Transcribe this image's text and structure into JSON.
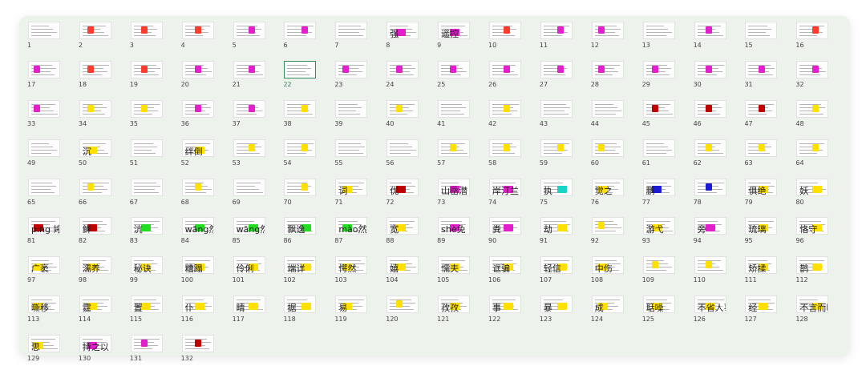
{
  "grid": {
    "selected": 22,
    "slides": [
      {
        "n": "1",
        "caption": "",
        "hl": ""
      },
      {
        "n": "2",
        "caption": "",
        "hl": "#ff3b30"
      },
      {
        "n": "3",
        "caption": "",
        "hl": "#ff3b30"
      },
      {
        "n": "4",
        "caption": "",
        "hl": "#ff3b30"
      },
      {
        "n": "5",
        "caption": "",
        "hl": "#e31ecb"
      },
      {
        "n": "6",
        "caption": "",
        "hl": "#e31ecb"
      },
      {
        "n": "7",
        "caption": "",
        "hl": ""
      },
      {
        "n": "8",
        "caption": "强",
        "hl": "#e31ecb"
      },
      {
        "n": "9",
        "caption": "遥控",
        "hl": "#e31ecb"
      },
      {
        "n": "10",
        "caption": "",
        "hl": "#ff3b30"
      },
      {
        "n": "11",
        "caption": "",
        "hl": "#e31ecb"
      },
      {
        "n": "12",
        "caption": "",
        "hl": "#e31ecb"
      },
      {
        "n": "13",
        "caption": "",
        "hl": ""
      },
      {
        "n": "14",
        "caption": "",
        "hl": "#e31ecb"
      },
      {
        "n": "15",
        "caption": "",
        "hl": ""
      },
      {
        "n": "16",
        "caption": "",
        "hl": "#ff3b30"
      },
      {
        "n": "17",
        "caption": "",
        "hl": "#e31ecb"
      },
      {
        "n": "18",
        "caption": "",
        "hl": "#ff3b30"
      },
      {
        "n": "19",
        "caption": "",
        "hl": "#ff3b30"
      },
      {
        "n": "20",
        "caption": "",
        "hl": "#e31ecb"
      },
      {
        "n": "21",
        "caption": "",
        "hl": "#e31ecb"
      },
      {
        "n": "22",
        "caption": "",
        "hl": ""
      },
      {
        "n": "23",
        "caption": "",
        "hl": "#e31ecb"
      },
      {
        "n": "24",
        "caption": "",
        "hl": "#e31ecb"
      },
      {
        "n": "25",
        "caption": "",
        "hl": "#e31ecb"
      },
      {
        "n": "26",
        "caption": "",
        "hl": "#e31ecb"
      },
      {
        "n": "27",
        "caption": "",
        "hl": "#e31ecb"
      },
      {
        "n": "28",
        "caption": "",
        "hl": "#e31ecb"
      },
      {
        "n": "29",
        "caption": "",
        "hl": "#e31ecb"
      },
      {
        "n": "30",
        "caption": "",
        "hl": "#e31ecb"
      },
      {
        "n": "31",
        "caption": "",
        "hl": "#e31ecb"
      },
      {
        "n": "32",
        "caption": "",
        "hl": "#e31ecb"
      },
      {
        "n": "33",
        "caption": "",
        "hl": "#e31ecb"
      },
      {
        "n": "34",
        "caption": "",
        "hl": "#ffe000"
      },
      {
        "n": "35",
        "caption": "",
        "hl": "#ffe000"
      },
      {
        "n": "36",
        "caption": "",
        "hl": "#e31ecb"
      },
      {
        "n": "37",
        "caption": "",
        "hl": "#e31ecb"
      },
      {
        "n": "38",
        "caption": "",
        "hl": "#ffe000"
      },
      {
        "n": "39",
        "caption": "",
        "hl": ""
      },
      {
        "n": "40",
        "caption": "",
        "hl": "#ffe000"
      },
      {
        "n": "41",
        "caption": "",
        "hl": ""
      },
      {
        "n": "42",
        "caption": "",
        "hl": "#ffe000"
      },
      {
        "n": "43",
        "caption": "",
        "hl": ""
      },
      {
        "n": "44",
        "caption": "",
        "hl": ""
      },
      {
        "n": "45",
        "caption": "",
        "hl": "#c00000"
      },
      {
        "n": "46",
        "caption": "",
        "hl": "#c00000"
      },
      {
        "n": "47",
        "caption": "",
        "hl": "#c00000"
      },
      {
        "n": "48",
        "caption": "",
        "hl": "#ffe000"
      },
      {
        "n": "49",
        "caption": "",
        "hl": ""
      },
      {
        "n": "50",
        "caption": "沉",
        "hl": "#ffe000"
      },
      {
        "n": "51",
        "caption": "",
        "hl": ""
      },
      {
        "n": "52",
        "caption": "绊倒",
        "hl": "#ffe000"
      },
      {
        "n": "53",
        "caption": "",
        "hl": "#ffe000"
      },
      {
        "n": "54",
        "caption": "",
        "hl": "#ffe000"
      },
      {
        "n": "55",
        "caption": "",
        "hl": ""
      },
      {
        "n": "56",
        "caption": "",
        "hl": ""
      },
      {
        "n": "57",
        "caption": "",
        "hl": "#ffe000"
      },
      {
        "n": "58",
        "caption": "",
        "hl": "#ffe000"
      },
      {
        "n": "59",
        "caption": "",
        "hl": "#ffe000"
      },
      {
        "n": "60",
        "caption": "",
        "hl": "#ffe000"
      },
      {
        "n": "61",
        "caption": "",
        "hl": ""
      },
      {
        "n": "62",
        "caption": "",
        "hl": "#ffe000"
      },
      {
        "n": "63",
        "caption": "",
        "hl": "#ffe000"
      },
      {
        "n": "64",
        "caption": "",
        "hl": "#ffe000"
      },
      {
        "n": "65",
        "caption": "",
        "hl": ""
      },
      {
        "n": "66",
        "caption": "",
        "hl": "#ffe000"
      },
      {
        "n": "67",
        "caption": "",
        "hl": ""
      },
      {
        "n": "68",
        "caption": "",
        "hl": "#ffe000"
      },
      {
        "n": "69",
        "caption": "",
        "hl": ""
      },
      {
        "n": "70",
        "caption": "",
        "hl": "#ffe000"
      },
      {
        "n": "71",
        "caption": "词",
        "hl": "#ffe000"
      },
      {
        "n": "72",
        "caption": "优",
        "hl": "#c00000"
      },
      {
        "n": "73",
        "caption": "山岳潜",
        "hl": "#e31ecb"
      },
      {
        "n": "74",
        "caption": "岸汀兰",
        "hl": "#e31ecb"
      },
      {
        "n": "75",
        "caption": "执",
        "hl": "#19d3c5"
      },
      {
        "n": "76",
        "caption": "觉之",
        "hl": "#ffe000"
      },
      {
        "n": "77",
        "caption": "鹏",
        "hl": "#1b1bd6"
      },
      {
        "n": "78",
        "caption": "",
        "hl": "#1b1bd6"
      },
      {
        "n": "79",
        "caption": "俱绝",
        "hl": "#ffe000"
      },
      {
        "n": "80",
        "caption": "妖",
        "hl": "#ffe000"
      },
      {
        "n": "81",
        "caption": "ping 婷",
        "hl": "#c00000"
      },
      {
        "n": "82",
        "caption": "鲜",
        "hl": "#c00000"
      },
      {
        "n": "83",
        "caption": "沆",
        "hl": "#22dd22"
      },
      {
        "n": "84",
        "caption": "wāng然",
        "hl": "#22dd22"
      },
      {
        "n": "85",
        "caption": "wāng然",
        "hl": "#22dd22"
      },
      {
        "n": "86",
        "caption": "飘逸",
        "hl": "#22dd22"
      },
      {
        "n": "87",
        "caption": "mào然",
        "hl": "#22dd22"
      },
      {
        "n": "88",
        "caption": "宽",
        "hl": "#ffe000"
      },
      {
        "n": "89",
        "caption": "shè免",
        "hl": "#e31ecb"
      },
      {
        "n": "90",
        "caption": "粪",
        "hl": "#e31ecb"
      },
      {
        "n": "91",
        "caption": "劫",
        "hl": "#ffe000"
      },
      {
        "n": "92",
        "caption": "",
        "hl": "#ffe000"
      },
      {
        "n": "93",
        "caption": "游弋",
        "hl": "#ffe000"
      },
      {
        "n": "94",
        "caption": "旁",
        "hl": "#e31ecb"
      },
      {
        "n": "95",
        "caption": "琉璃",
        "hl": "#ffe000"
      },
      {
        "n": "96",
        "caption": "恪守",
        "hl": "#ffe000"
      },
      {
        "n": "97",
        "caption": "广袤",
        "hl": "#ffe000"
      },
      {
        "n": "98",
        "caption": "濡养",
        "hl": "#ffe000"
      },
      {
        "n": "99",
        "caption": "秘诀",
        "hl": "#ffe000"
      },
      {
        "n": "100",
        "caption": "糟蹋",
        "hl": "#ffe000"
      },
      {
        "n": "101",
        "caption": "伶俐",
        "hl": "#ffe000"
      },
      {
        "n": "102",
        "caption": "端详",
        "hl": "#ffe000"
      },
      {
        "n": "103",
        "caption": "愕然",
        "hl": "#ffe000"
      },
      {
        "n": "104",
        "caption": "嬉",
        "hl": "#ffe000"
      },
      {
        "n": "105",
        "caption": "懦夫",
        "hl": "#ffe000"
      },
      {
        "n": "106",
        "caption": "诓骗",
        "hl": "#ffe000"
      },
      {
        "n": "107",
        "caption": "轻信",
        "hl": "#ffe000"
      },
      {
        "n": "108",
        "caption": "中伤",
        "hl": "#ffe000"
      },
      {
        "n": "109",
        "caption": "",
        "hl": "#ffe000"
      },
      {
        "n": "110",
        "caption": "",
        "hl": "#ffe000"
      },
      {
        "n": "111",
        "caption": "矫揉",
        "hl": "#ffe000"
      },
      {
        "n": "112",
        "caption": "鹊",
        "hl": "#ffe000"
      },
      {
        "n": "113",
        "caption": "嘶移",
        "hl": "#ffe000"
      },
      {
        "n": "114",
        "caption": "霆",
        "hl": "#ffe000"
      },
      {
        "n": "115",
        "caption": "置",
        "hl": "#ffe000"
      },
      {
        "n": "116",
        "caption": "仆",
        "hl": "#ffe000"
      },
      {
        "n": "117",
        "caption": "睛",
        "hl": "#ffe000"
      },
      {
        "n": "118",
        "caption": "据",
        "hl": "#ffe000"
      },
      {
        "n": "119",
        "caption": "易",
        "hl": "#ffe000"
      },
      {
        "n": "120",
        "caption": "",
        "hl": "#ffe000"
      },
      {
        "n": "121",
        "caption": "孜孜",
        "hl": "#ffe000"
      },
      {
        "n": "122",
        "caption": "事",
        "hl": "#ffe000"
      },
      {
        "n": "123",
        "caption": "暴",
        "hl": "#ffe000"
      },
      {
        "n": "124",
        "caption": "成",
        "hl": "#ffe000"
      },
      {
        "n": "125",
        "caption": "聒噪",
        "hl": "#ffe000"
      },
      {
        "n": "126",
        "caption": "不省人事",
        "hl": "#ffe000"
      },
      {
        "n": "127",
        "caption": "经",
        "hl": "#ffe000"
      },
      {
        "n": "128",
        "caption": "不言而喻",
        "hl": "#ffe000"
      },
      {
        "n": "129",
        "caption": "思",
        "hl": "#ffe000"
      },
      {
        "n": "130",
        "caption": "持之以",
        "hl": "#e31ecb"
      },
      {
        "n": "131",
        "caption": "",
        "hl": "#e31ecb"
      },
      {
        "n": "132",
        "caption": "",
        "hl": "#c00000"
      }
    ]
  }
}
